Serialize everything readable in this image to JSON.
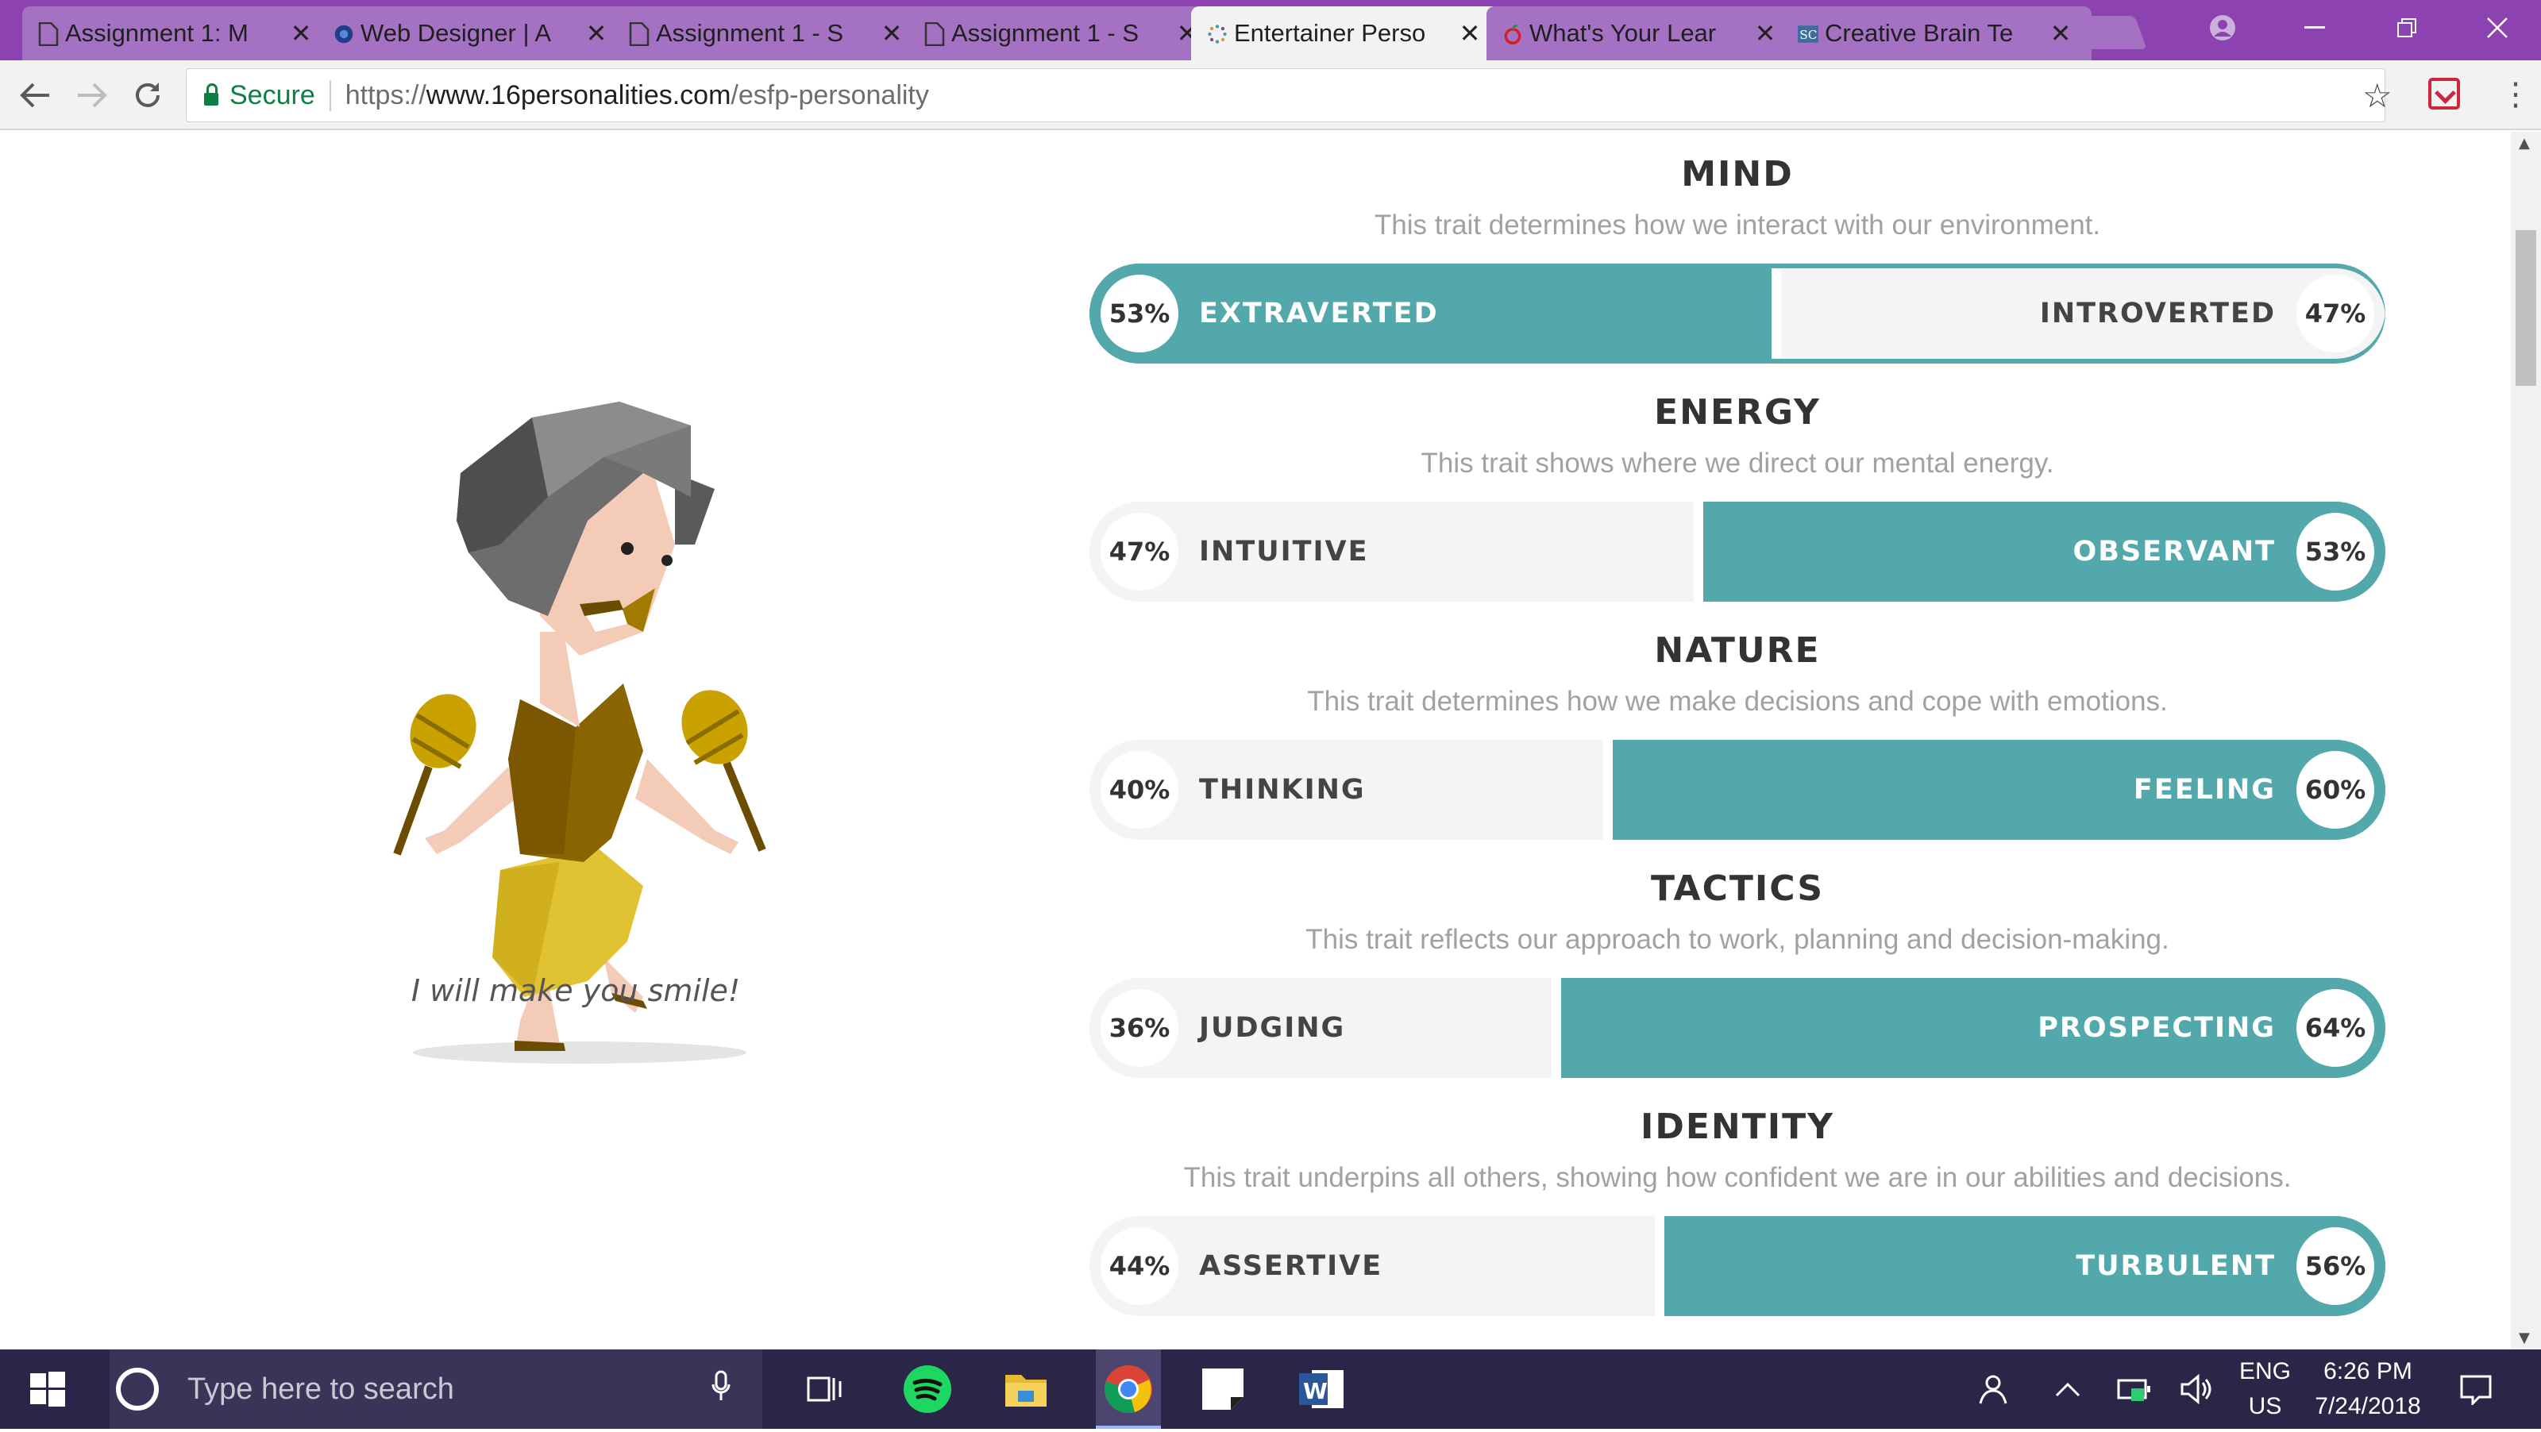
{
  "browser": {
    "tabs": [
      {
        "title": "Assignment 1: M",
        "icon": "document-icon",
        "active": false
      },
      {
        "title": "Web Designer | A",
        "icon": "globe-icon",
        "active": false
      },
      {
        "title": "Assignment 1 - S",
        "icon": "document-icon",
        "active": false
      },
      {
        "title": "Assignment 1 - S",
        "icon": "document-icon",
        "active": false
      },
      {
        "title": "Entertainer Perso",
        "icon": "sixteen-personalities-icon",
        "active": true
      },
      {
        "title": "What's Your Lear",
        "icon": "apple-icon",
        "active": false
      },
      {
        "title": "Creative Brain Te",
        "icon": "sc-icon",
        "active": false
      }
    ],
    "secure_label": "Secure",
    "url_protocol": "https://",
    "url_host": "www.16personalities.com",
    "url_path": "/esfp-personality"
  },
  "page": {
    "caption": "I will make you smile!",
    "accent_color": "#52a8aa",
    "traits": [
      {
        "title": "MIND",
        "description": "This trait determines how we interact with our environment.",
        "left_label": "EXTRAVERTED",
        "left_pct": "53%",
        "right_label": "INTROVERTED",
        "right_pct": "47%",
        "left_value": 53,
        "dominant": "left"
      },
      {
        "title": "ENERGY",
        "description": "This trait shows where we direct our mental energy.",
        "left_label": "INTUITIVE",
        "left_pct": "47%",
        "right_label": "OBSERVANT",
        "right_pct": "53%",
        "left_value": 47,
        "dominant": "right"
      },
      {
        "title": "NATURE",
        "description": "This trait determines how we make decisions and cope with emotions.",
        "left_label": "THINKING",
        "left_pct": "40%",
        "right_label": "FEELING",
        "right_pct": "60%",
        "left_value": 40,
        "dominant": "right"
      },
      {
        "title": "TACTICS",
        "description": "This trait reflects our approach to work, planning and decision-making.",
        "left_label": "JUDGING",
        "left_pct": "36%",
        "right_label": "PROSPECTING",
        "right_pct": "64%",
        "left_value": 36,
        "dominant": "right"
      },
      {
        "title": "IDENTITY",
        "description": "This trait underpins all others, showing how confident we are in our abilities and decisions.",
        "left_label": "ASSERTIVE",
        "left_pct": "44%",
        "right_label": "TURBULENT",
        "right_pct": "56%",
        "left_value": 44,
        "dominant": "right"
      }
    ]
  },
  "taskbar": {
    "search_placeholder": "Type here to search",
    "language": "ENG",
    "region": "US",
    "time": "6:26 PM",
    "date": "7/24/2018"
  }
}
